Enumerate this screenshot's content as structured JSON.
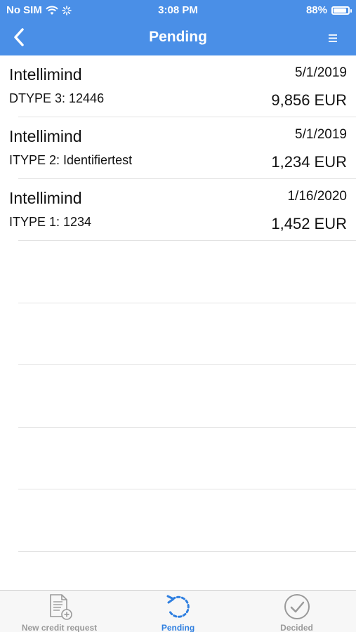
{
  "status_bar": {
    "carrier": "No SIM",
    "time": "3:08 PM",
    "battery": "88%"
  },
  "nav": {
    "title": "Pending"
  },
  "requests": [
    {
      "name": "Intellimind",
      "date": "5/1/2019",
      "type": "DTYPE 3: 12446",
      "amount": "9,856 EUR"
    },
    {
      "name": "Intellimind",
      "date": "5/1/2019",
      "type": "ITYPE 2: Identifiertest",
      "amount": "1,234 EUR"
    },
    {
      "name": "Intellimind",
      "date": "1/16/2020",
      "type": "ITYPE 1: 1234",
      "amount": "1,452 EUR"
    }
  ],
  "tabs": [
    {
      "label": "New credit request",
      "icon": "new-document-icon",
      "active": false
    },
    {
      "label": "Pending",
      "icon": "refresh-circle-icon",
      "active": true
    },
    {
      "label": "Decided",
      "icon": "checkmark-circle-icon",
      "active": false
    }
  ],
  "colors": {
    "header": "#4a8fe7",
    "active_tab": "#2f7fe0",
    "inactive_tab": "#9a9a9a"
  }
}
